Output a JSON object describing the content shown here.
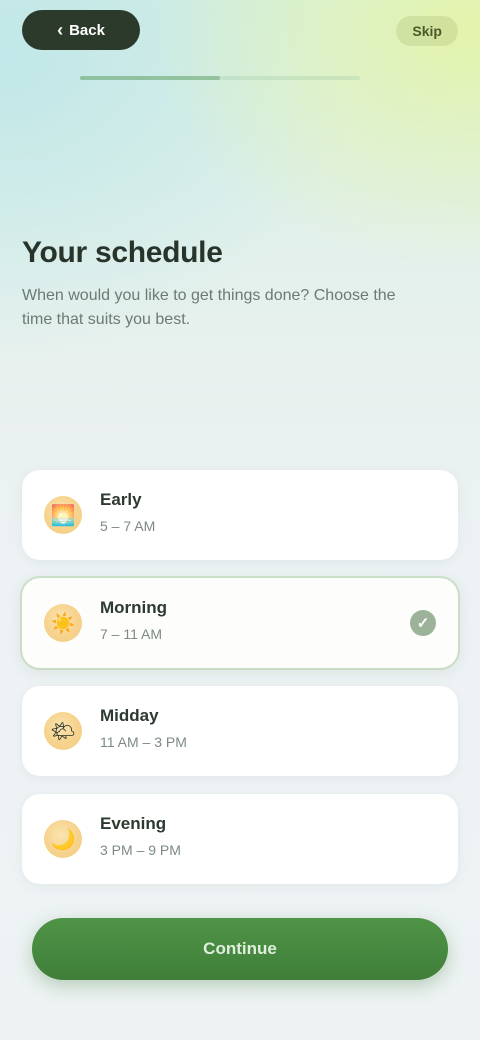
{
  "topbar": {
    "back_label": "Back",
    "skip_label": "Skip"
  },
  "progress": {
    "fraction": 0.5
  },
  "header": {
    "title": "Your schedule",
    "subtitle": "When would you like to get things done? Choose the time that suits you best."
  },
  "options": [
    {
      "label": "Early",
      "desc": "5 – 7 AM",
      "icon": "sunrise-icon",
      "glyph": "🌅",
      "selected": false
    },
    {
      "label": "Morning",
      "desc": "7 – 11 AM",
      "icon": "sun-icon",
      "glyph": "☀️",
      "selected": true
    },
    {
      "label": "Midday",
      "desc": "11 AM – 3 PM",
      "icon": "sun-icon",
      "glyph": "🌤",
      "selected": false
    },
    {
      "label": "Evening",
      "desc": "3 PM – 9 PM",
      "icon": "moon-icon",
      "glyph": "🌙",
      "selected": false
    }
  ],
  "check_glyph": "✓",
  "continue_label": "Continue",
  "colors": {
    "accent": "#3f7f39",
    "card": "#ffffff",
    "icon_circle": "#f6d28c"
  }
}
